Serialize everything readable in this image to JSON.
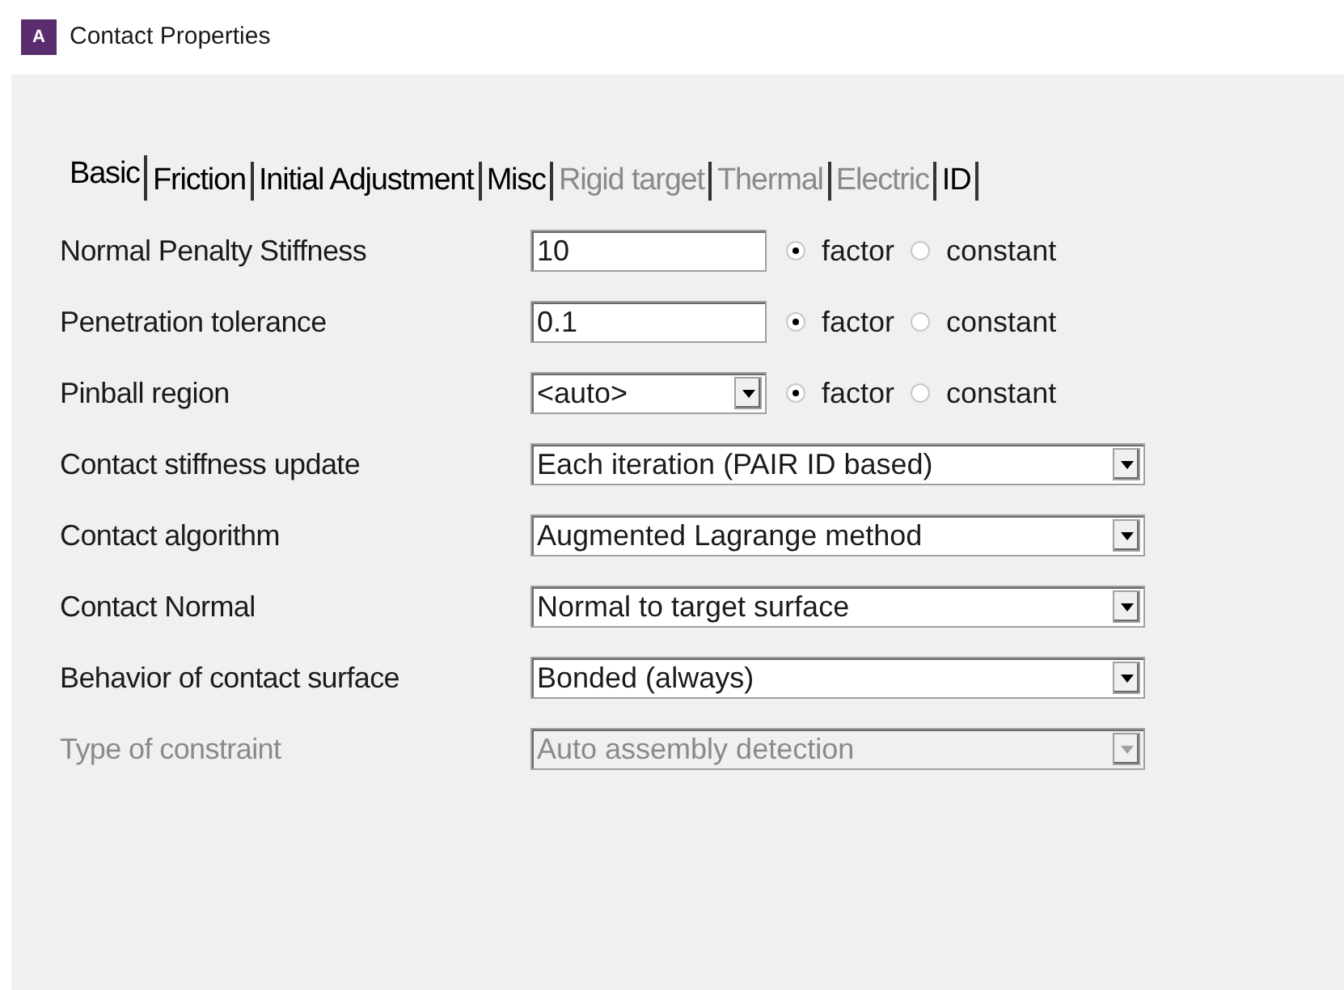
{
  "window": {
    "title": "Contact Properties",
    "logo": "A"
  },
  "tabs": [
    {
      "label": "Basic",
      "selected": true,
      "disabled": false
    },
    {
      "label": "Friction",
      "selected": false,
      "disabled": false
    },
    {
      "label": "Initial Adjustment",
      "selected": false,
      "disabled": false
    },
    {
      "label": "Misc",
      "selected": false,
      "disabled": false
    },
    {
      "label": "Rigid target",
      "selected": false,
      "disabled": true
    },
    {
      "label": "Thermal",
      "selected": false,
      "disabled": true
    },
    {
      "label": "Electric",
      "selected": false,
      "disabled": true
    },
    {
      "label": "ID",
      "selected": false,
      "disabled": false
    }
  ],
  "rows": [
    {
      "label": "Normal Penalty Stiffness",
      "kind": "text",
      "value": "10",
      "disabled": false,
      "options": [
        {
          "label": "factor",
          "selected": true
        },
        {
          "label": "constant",
          "selected": false
        }
      ]
    },
    {
      "label": "Penetration tolerance",
      "kind": "text",
      "value": "0.1",
      "disabled": false,
      "options": [
        {
          "label": "factor",
          "selected": true
        },
        {
          "label": "constant",
          "selected": false
        }
      ]
    },
    {
      "label": "Pinball region",
      "kind": "combo",
      "value": "<auto>",
      "disabled": false,
      "options": [
        {
          "label": "factor",
          "selected": true
        },
        {
          "label": "constant",
          "selected": false
        }
      ]
    },
    {
      "label": "Contact stiffness update",
      "kind": "select",
      "value": "Each iteration (PAIR ID based)",
      "disabled": false
    },
    {
      "label": "Contact algorithm",
      "kind": "select",
      "value": "Augmented Lagrange method",
      "disabled": false
    },
    {
      "label": "Contact Normal",
      "kind": "select",
      "value": "Normal to target surface",
      "disabled": false
    },
    {
      "label": "Behavior of contact surface",
      "kind": "select",
      "value": "Bonded (always)",
      "disabled": false
    },
    {
      "label": "Type of constraint",
      "kind": "select",
      "value": "Auto assembly detection",
      "disabled": true
    }
  ]
}
